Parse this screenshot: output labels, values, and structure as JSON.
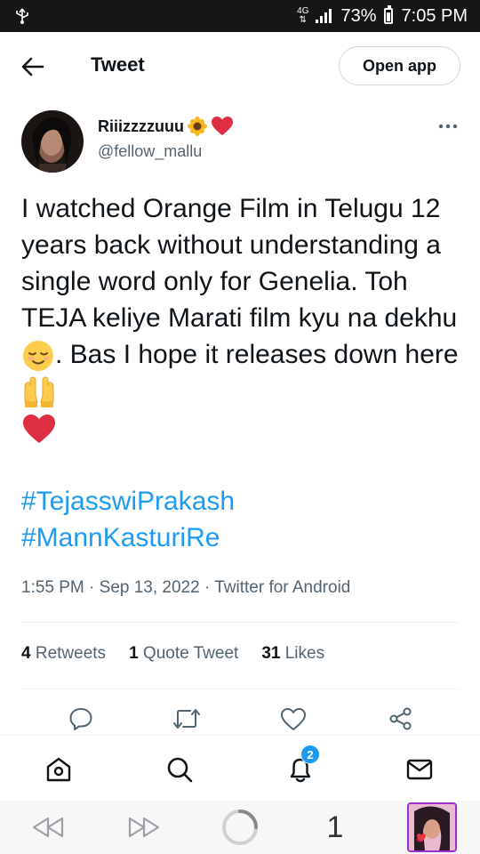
{
  "status_bar": {
    "network": "4G",
    "battery": "73%",
    "time": "7:05 PM"
  },
  "header": {
    "title": "Tweet",
    "open_app_label": "Open app"
  },
  "tweet": {
    "author_name": "Riiizzzzuuu",
    "author_name_emojis": [
      "sunflower",
      "red-heart"
    ],
    "author_handle": "@fellow_mallu",
    "text_segments": [
      "I watched Orange Film in Telugu 12 years back without understanding a single word only for Genelia. Toh TEJA keliye Marati film kyu na dekhu",
      ". Bas I hope it releases down here"
    ],
    "hashtags": [
      "#TejasswiPrakash",
      "#MannKasturiRe"
    ],
    "timestamp": "1:55 PM · Sep 13, 2022 · Twitter for Android"
  },
  "stats": {
    "retweets_count": "4",
    "retweets_label": "Retweets",
    "quotes_count": "1",
    "quotes_label": "Quote Tweet",
    "likes_count": "31",
    "likes_label": "Likes"
  },
  "bottom_nav": {
    "notification_badge": "2"
  },
  "browser_bar": {
    "tab_count": "1"
  },
  "colors": {
    "accent": "#1d9bf0",
    "text_primary": "#0f1419",
    "text_secondary": "#536471",
    "status_bar_bg": "#161616"
  }
}
